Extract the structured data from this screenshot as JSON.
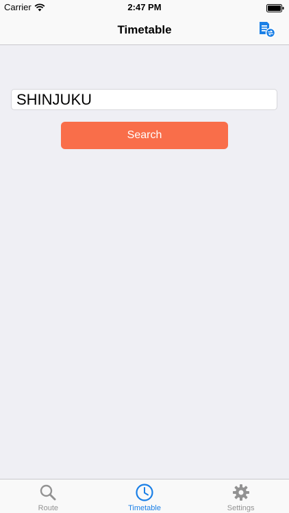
{
  "status_bar": {
    "carrier": "Carrier",
    "time": "2:47 PM"
  },
  "nav_bar": {
    "title": "Timetable",
    "action_icon": "document-exchange-icon"
  },
  "search": {
    "value": "SHINJUKU",
    "button_label": "Search"
  },
  "tabs": [
    {
      "label": "Route",
      "icon": "search-icon",
      "active": false
    },
    {
      "label": "Timetable",
      "icon": "clock-icon",
      "active": true
    },
    {
      "label": "Settings",
      "icon": "gear-icon",
      "active": false
    }
  ],
  "colors": {
    "accent": "#1a7fe6",
    "button": "#f96e4a",
    "inactive": "#929292",
    "background": "#efeff4"
  }
}
